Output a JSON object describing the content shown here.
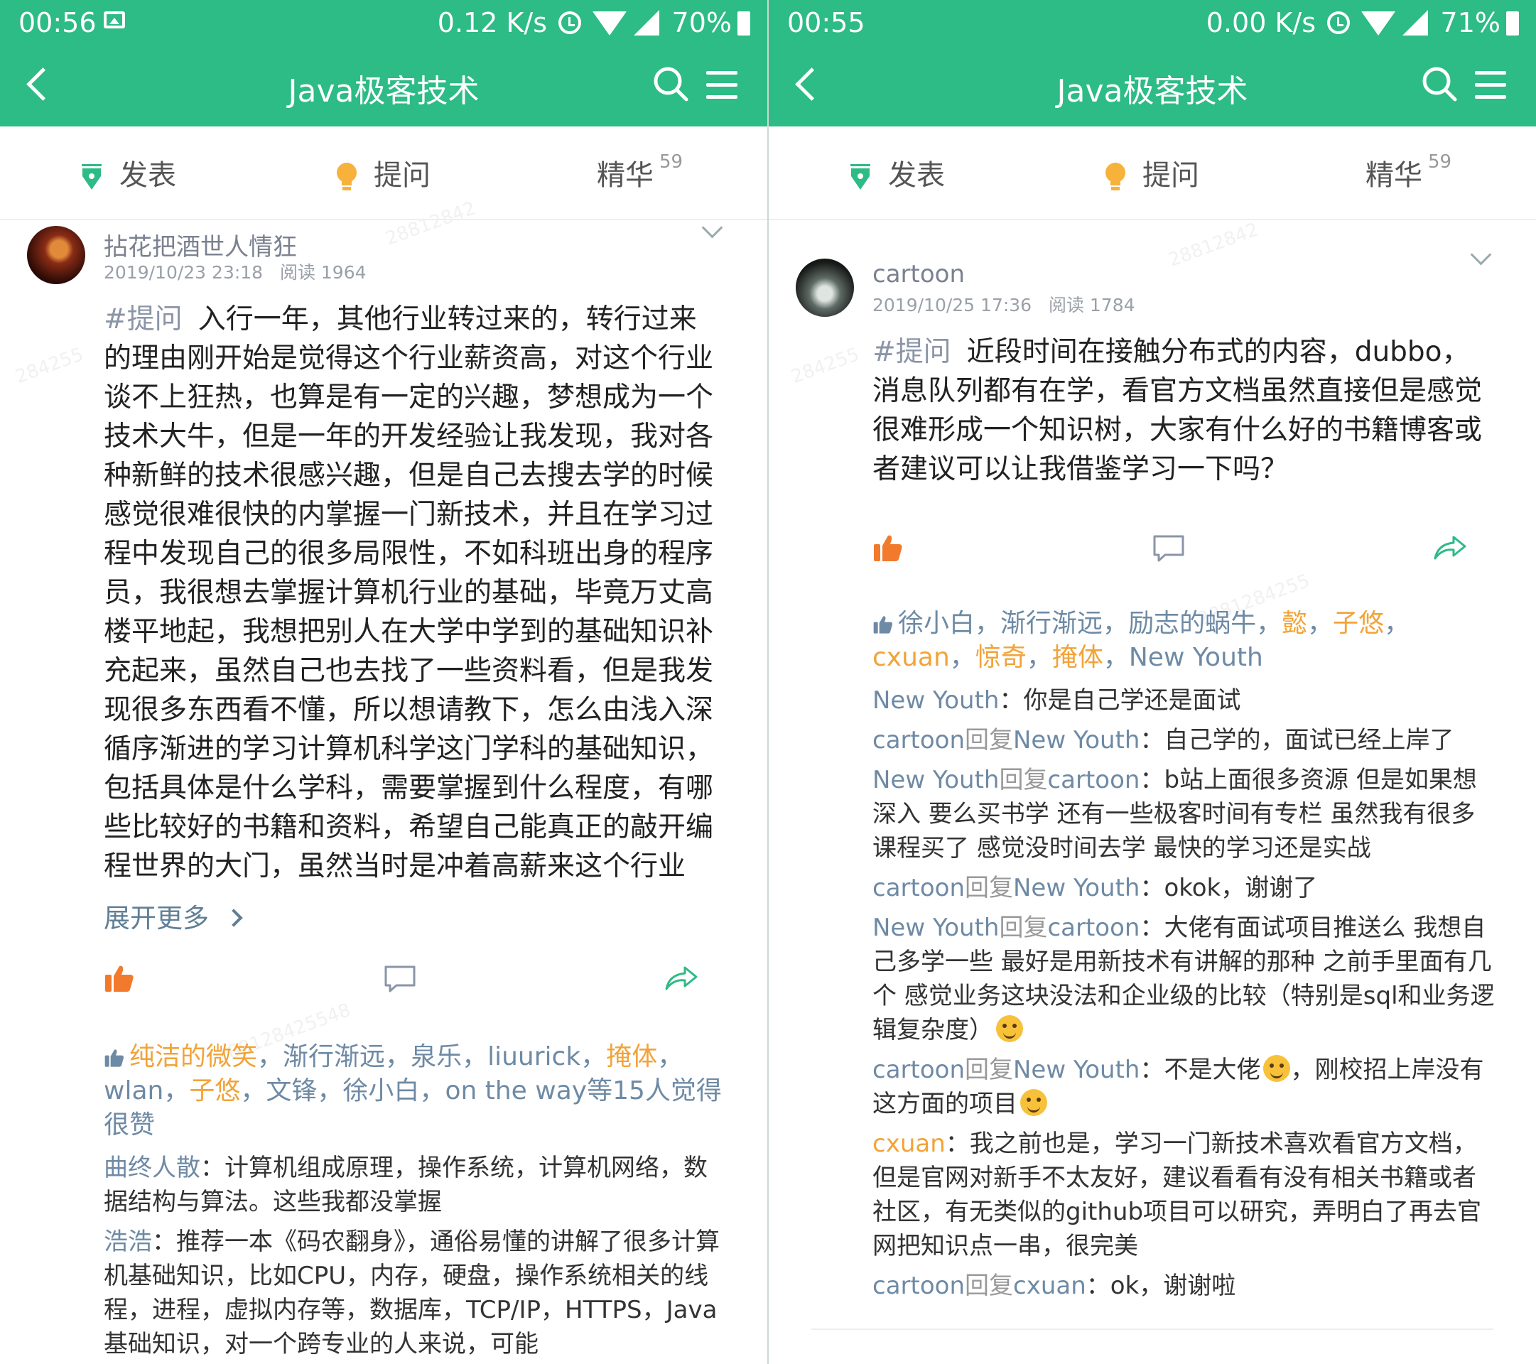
{
  "common": {
    "nav_title": "Java极客技术",
    "tabs": {
      "post": "发表",
      "ask": "提问",
      "elite": "精华",
      "elite_count": "59"
    },
    "accent_color": "#2dbb86",
    "highlight_color": "#f2a338",
    "name_color": "#6e8aa5"
  },
  "left": {
    "status": {
      "time": "00:56",
      "speed": "0.12 K/s",
      "battery": "70%"
    },
    "post": {
      "author": "拈花把酒世人情狂",
      "date": "2019/10/23 23:18",
      "reads": "阅读 1964",
      "tag": "#提问",
      "body": "入行一年，其他行业转过来的，转行过来的理由刚开始是觉得这个行业薪资高，对这个行业谈不上狂热，也算是有一定的兴趣，梦想成为一个技术大牛，但是一年的开发经验让我发现，我对各种新鲜的技术很感兴趣，但是自己去搜去学的时候感觉很难很快的内掌握一门新技术，并且在学习过程中发现自己的很多局限性，不如科班出身的程序员，我很想去掌握计算机行业的基础，毕竟万丈高楼平地起，我想把别人在大学中学到的基础知识补充起来，虽然自己也去找了一些资料看，但是我发现很多东西看不懂，所以想请教下，怎么由浅入深循序渐进的学习计算机科学这门学科的基础知识，包括具体是什么学科，需要掌握到什么程度，有哪些比较好的书籍和资料，希望自己能真正的敲开编程世界的大门，虽然当时是冲着高薪来这个行业",
      "more": "展开更多",
      "likes": {
        "names": [
          "纯洁的微笑",
          "渐行渐远",
          "泉乐",
          "liuurick",
          "掩体",
          "wlan",
          "子悠",
          "文锋",
          "徐小白",
          "on the way"
        ],
        "suffix": "等15人觉得很赞"
      },
      "comments": [
        {
          "name": "曲终人散",
          "text": "计算机组成原理，操作系统，计算机网络，数据结构与算法。这些我都没掌握"
        },
        {
          "name": "浩浩",
          "text": "推荐一本《码农翻身》，通俗易懂的讲解了很多计算机基础知识，比如CPU，内存，硬盘，操作系统相关的线程，进程，虚拟内存等，数据库，TCP/IP，HTTPS，Java基础知识，对一个跨专业的人来说，可能"
        }
      ]
    }
  },
  "right": {
    "status": {
      "time": "00:55",
      "speed": "0.00 K/s",
      "battery": "71%"
    },
    "post": {
      "author": "cartoon",
      "date": "2019/10/25 17:36",
      "reads": "阅读 1784",
      "tag": "#提问",
      "body": "近段时间在接触分布式的内容，dubbo，消息队列都有在学，看官方文档虽然直接但是感觉很难形成一个知识树，大家有什么好的书籍博客或者建议可以让我借鉴学习一下吗？",
      "likes": {
        "names": [
          "徐小白",
          "渐行渐远",
          "励志的蜗牛",
          "懿",
          "子悠",
          "cxuan",
          "惊奇",
          "掩体",
          "New Youth"
        ]
      },
      "reply_word": "回复",
      "comments": [
        {
          "name": "New  Youth",
          "text": "你是自己学还是面试"
        },
        {
          "name": "cartoon",
          "to": "New  Youth",
          "text": "自己学的，面试已经上岸了"
        },
        {
          "name": "New  Youth",
          "to": "cartoon",
          "text": "b站上面很多资源  但是如果想深入  要么买书学  还有一些极客时间有专栏  虽然我有很多课程买了  感觉没时间去学    最快的学习还是实战"
        },
        {
          "name": "cartoon",
          "to": "New  Youth",
          "text": "okok，谢谢了"
        },
        {
          "name": "New  Youth",
          "to": "cartoon",
          "text": "大佬有面试项目推送么  我想自己多学一些  最好是用新技术有讲解的那种  之前手里面有几个  感觉业务这块没法和企业级的比较（特别是sql和业务逻辑复杂度）"
        },
        {
          "name": "cartoon",
          "to": "New  Youth",
          "text": "不是大佬",
          "text2": "，刚校招上岸没有这方面的项目"
        },
        {
          "name": "cxuan",
          "text": "我之前也是，学习一门新技术喜欢看官方文档，但是官网对新手不太友好，建议看看有没有相关书籍或者社区，有无类似的github项目可以研究，弄明白了再去官网把知识点一串，很完美"
        },
        {
          "name": "cartoon",
          "to": "cxuan",
          "text": "ok，谢谢啦"
        }
      ]
    }
  }
}
